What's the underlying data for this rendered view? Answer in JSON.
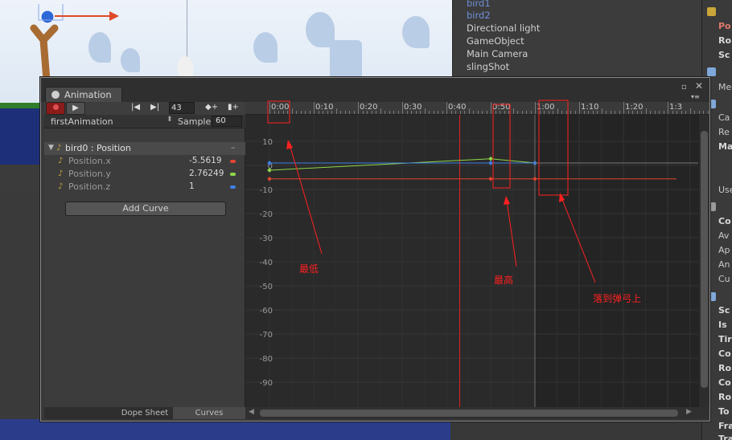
{
  "hierarchy": {
    "items": [
      {
        "label": "bird1",
        "highlight": true
      },
      {
        "label": "bird2",
        "highlight": true
      },
      {
        "label": "Directional light",
        "highlight": false
      },
      {
        "label": "GameObject",
        "highlight": false
      },
      {
        "label": "Main Camera",
        "highlight": false
      },
      {
        "label": "slingShot",
        "highlight": false
      }
    ]
  },
  "inspector": {
    "rows": [
      "Po",
      "Ro",
      "Sc",
      "Me",
      "Ca",
      "Re",
      "Ma",
      "Use",
      "Co",
      "Av",
      "Ap",
      "An",
      "Cu",
      "Sc",
      "Is",
      "Tir",
      "Co",
      "Ro",
      "Co",
      "Ro",
      "To",
      "Fra",
      "Tra"
    ]
  },
  "animation": {
    "tab_label": "Animation",
    "frame_value": "43",
    "clip_name": "firstAnimation",
    "sample_label": "Sample",
    "sample_value": "60",
    "properties": [
      {
        "name": "bird0 : Position",
        "value": "",
        "head": true,
        "color": ""
      },
      {
        "name": "Position.x",
        "value": "-5.5619",
        "head": false,
        "color": "#e0452f"
      },
      {
        "name": "Position.y",
        "value": "2.76249",
        "head": false,
        "color": "#8fd84a"
      },
      {
        "name": "Position.z",
        "value": "1",
        "head": false,
        "color": "#3f7fe6"
      }
    ],
    "add_curve_label": "Add Curve",
    "tabs": {
      "dope": "Dope Sheet",
      "curves": "Curves"
    },
    "ruler_labels": [
      "0:00",
      "0:10",
      "0:20",
      "0:30",
      "0:40",
      "0:50",
      "1:00",
      "1:10",
      "1:20",
      "1:3"
    ],
    "value_labels": [
      "10",
      "0",
      "-10",
      "-20",
      "-30",
      "-40",
      "-50",
      "-60",
      "-70",
      "-80",
      "-90"
    ],
    "scrub_time": "0:43"
  },
  "annotations": {
    "lowest": "最低",
    "highest": "最高",
    "landed": "落到弹弓上"
  },
  "colors": {
    "x_curve": "#e0452f",
    "y_curve": "#8fd84a",
    "z_curve": "#3f7fe6",
    "annotation": "#ff2020",
    "record": "#8b1a1a"
  },
  "icons": {
    "record": "record-icon",
    "play": "play-icon",
    "prev_key": "prev-key-icon",
    "next_key": "next-key-icon",
    "add_key": "add-key-icon",
    "add_event": "add-event-icon"
  },
  "chart_data": {
    "type": "line",
    "xlabel": "",
    "ylabel": "",
    "x_ticks": [
      "0:00",
      "0:10",
      "0:20",
      "0:30",
      "0:40",
      "0:50",
      "1:00",
      "1:10",
      "1:20",
      "1:3"
    ],
    "ylim": [
      -100,
      12
    ],
    "y_ticks": [
      10,
      0,
      -10,
      -20,
      -30,
      -40,
      -50,
      -60,
      -70,
      -80,
      -90
    ],
    "grid": true,
    "series": [
      {
        "name": "Position.x",
        "color": "#e0452f",
        "x": [
          0,
          50,
          60,
          92
        ],
        "y": [
          -5.6,
          -5.6,
          -5.6,
          -5.6
        ]
      },
      {
        "name": "Position.y",
        "color": "#8fd84a",
        "x": [
          0,
          50,
          60,
          92
        ],
        "y": [
          -2,
          2.76,
          1,
          1
        ]
      },
      {
        "name": "Position.z",
        "color": "#3f7fe6",
        "x": [
          0,
          50,
          60,
          92
        ],
        "y": [
          1,
          1,
          1,
          1
        ]
      }
    ]
  }
}
